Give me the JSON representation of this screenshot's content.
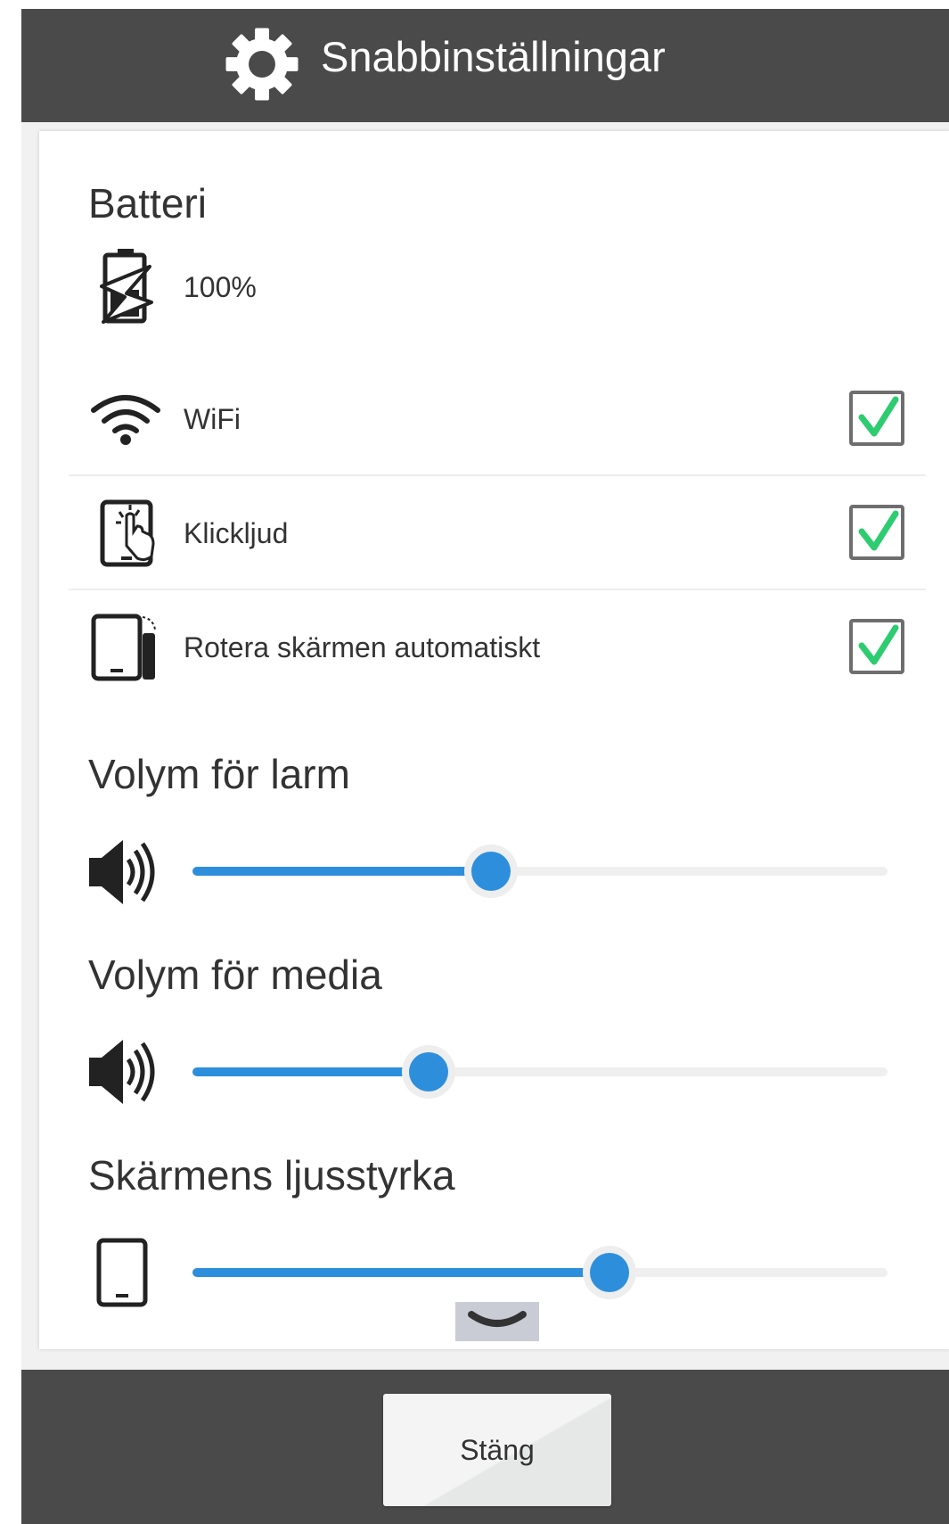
{
  "header": {
    "title": "Snabbinställningar",
    "icon": "gear-icon"
  },
  "battery": {
    "title": "Batteri",
    "value": "100%",
    "icon": "battery-charging-icon"
  },
  "toggles": [
    {
      "label": "WiFi",
      "icon": "wifi-icon",
      "checked": true
    },
    {
      "label": "Klickljud",
      "icon": "tablet-touch-icon",
      "checked": true
    },
    {
      "label": "Rotera skärmen automatiskt",
      "icon": "rotate-screen-icon",
      "checked": true
    }
  ],
  "sliders": [
    {
      "title": "Volym för larm",
      "icon": "speaker-icon",
      "level": 0.43
    },
    {
      "title": "Volym för media",
      "icon": "speaker-icon",
      "level": 0.34
    },
    {
      "title": "Skärmens ljusstyrka",
      "icon": "tablet-icon",
      "level": 0.6
    }
  ],
  "scroll": {
    "icon": "chevron-down-icon"
  },
  "footer": {
    "close_label": "Stäng"
  },
  "colors": {
    "accent": "#2d8fdc",
    "check": "#2ecc71",
    "header": "#4a4a4a"
  }
}
